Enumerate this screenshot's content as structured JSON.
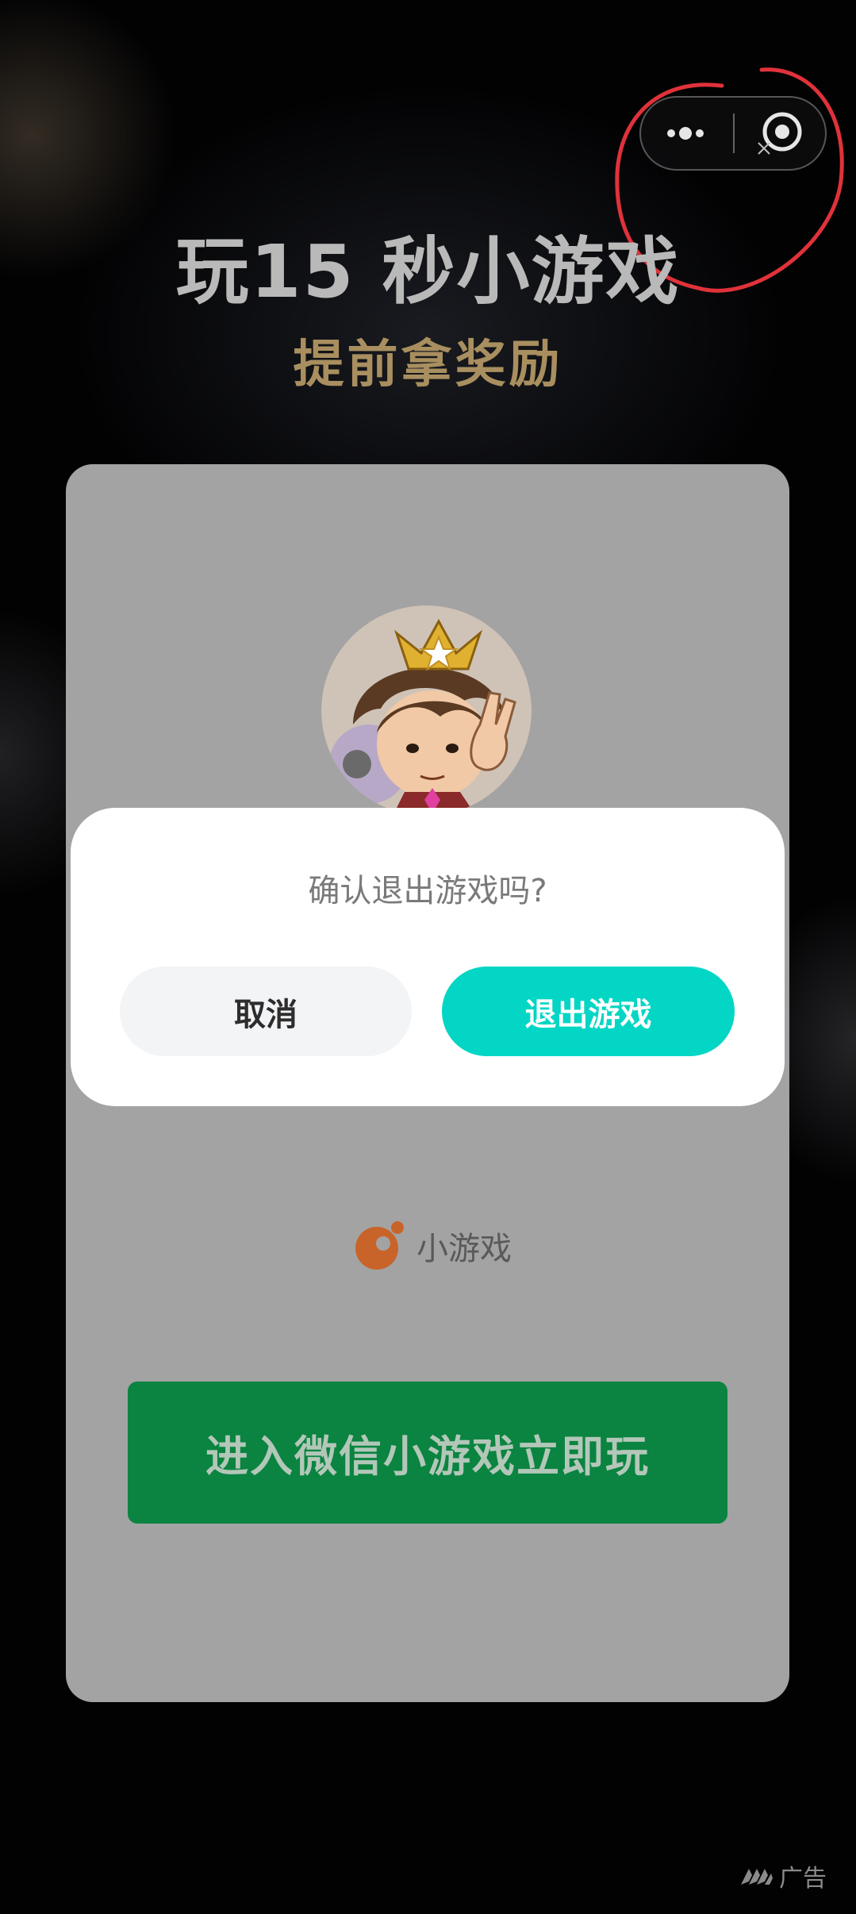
{
  "header": {
    "title": "玩15 秒小游戏",
    "subtitle": "提前拿奖励"
  },
  "capsule": {
    "more_icon": "more-dots-icon",
    "close_icon": "target-close-icon"
  },
  "card": {
    "avatar_icon": "game-avatar",
    "brand_logo_icon": "mini-game-logo-icon",
    "brand_label": "小游戏",
    "enter_button_label": "进入微信小游戏立即玩"
  },
  "dialog": {
    "message": "确认退出游戏吗?",
    "cancel_label": "取消",
    "exit_label": "退出游戏"
  },
  "ad": {
    "icon": "ad-logo-icon",
    "label": "广告"
  },
  "colors": {
    "exit_button": "#03d6c4",
    "enter_button": "#0a8440",
    "subtitle": "#a98f5f",
    "annotation_circle": "#e0323a"
  }
}
